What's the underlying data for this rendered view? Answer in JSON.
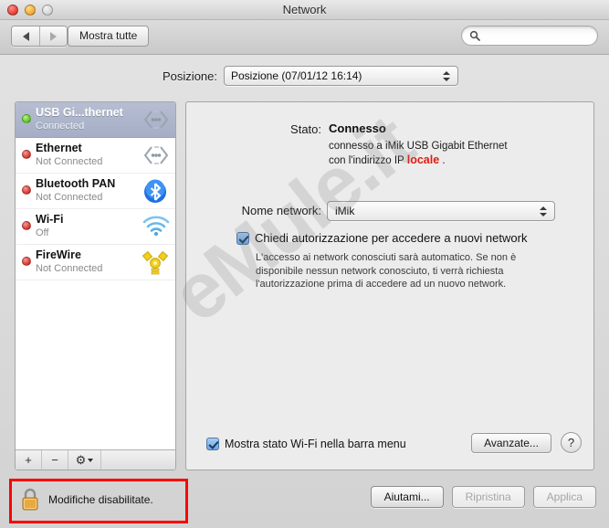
{
  "window": {
    "title": "Network",
    "traffic_lights": [
      "close-button",
      "minimize-button",
      "zoom-button"
    ]
  },
  "toolbar": {
    "back_label": "",
    "forward_label": "",
    "show_all_label": "Mostra tutte",
    "search_placeholder": "",
    "search_value": ""
  },
  "location": {
    "label": "Posizione:",
    "selected": "Posizione (07/01/12 16:14)"
  },
  "sidebar": {
    "interfaces": [
      {
        "name": "USB Gi...thernet",
        "status": "Connected",
        "dot": "green",
        "icon": "ethernet-icon",
        "selected": true
      },
      {
        "name": "Ethernet",
        "status": "Not Connected",
        "dot": "red",
        "icon": "ethernet-icon",
        "selected": false
      },
      {
        "name": "Bluetooth PAN",
        "status": "Not Connected",
        "dot": "red",
        "icon": "bluetooth-icon",
        "selected": false
      },
      {
        "name": "Wi-Fi",
        "status": "Off",
        "dot": "red",
        "icon": "wifi-icon",
        "selected": false
      },
      {
        "name": "FireWire",
        "status": "Not Connected",
        "dot": "red",
        "icon": "firewire-icon",
        "selected": false
      }
    ],
    "toolbar": {
      "add_label": "+",
      "remove_label": "−",
      "gear_label": "⚙"
    }
  },
  "panel": {
    "status_label": "Stato:",
    "status_value": "Connesso",
    "status_desc_line1": "connesso a iMik  USB Gigabit Ethernet",
    "status_desc_line2_prefix": "con l'indirizzo IP ",
    "status_desc_ip": "locale",
    "status_desc_line2_suffix": " .",
    "network_name_label": "Nome network:",
    "network_name_value": "iMik",
    "ask_join_label": "Chiedi autorizzazione per accedere a nuovi network",
    "ask_join_help": "L'accesso ai network conosciuti sarà automatico. Se non è disponibile nessun network conosciuto, ti verrà richiesta l'autorizzazione prima di accedere ad un nuovo network.",
    "show_wifi_label": "Mostra stato Wi-Fi nella barra menu",
    "advanced_label": "Avanzate...",
    "help_label": "?"
  },
  "footer": {
    "lock_text": "Modifiche disabilitate.",
    "help_me_label": "Aiutami...",
    "revert_label": "Ripristina",
    "apply_label": "Applica"
  },
  "watermark": {
    "text": "eMule.it"
  },
  "colors": {
    "accent_red": "#e01b10",
    "highlight_red": "#ff0000",
    "selected_row": "#aab3c9",
    "connected_green": "#5ec928",
    "disconnected_red": "#d63a33"
  }
}
